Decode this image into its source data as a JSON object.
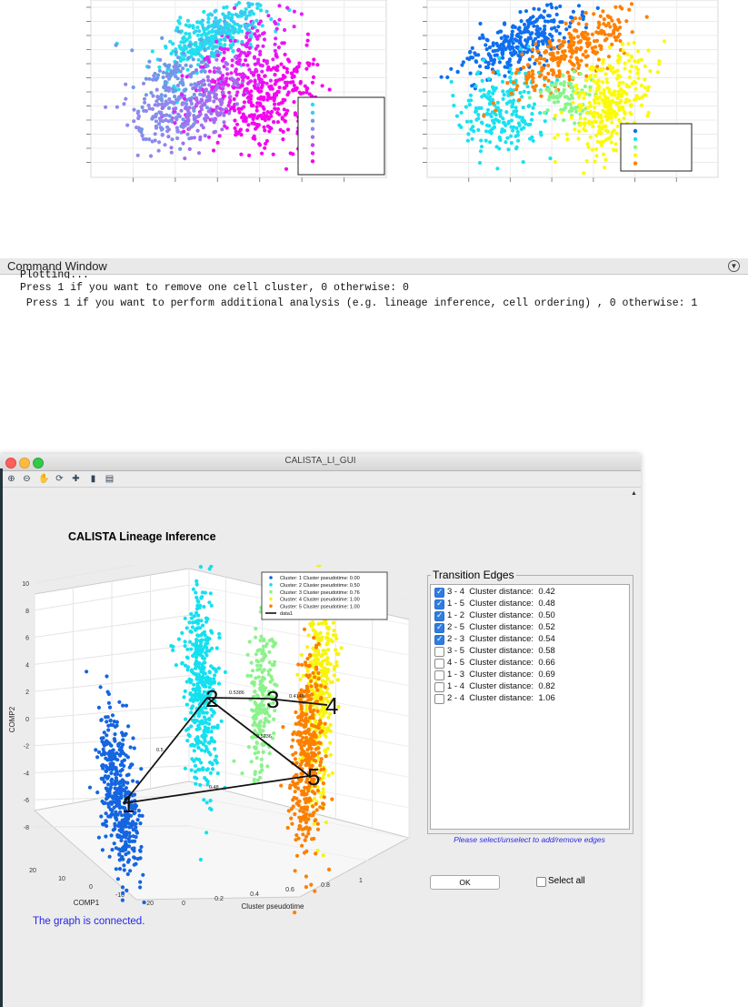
{
  "command_window": {
    "title": "Command Window",
    "lines": [
      "Plotting...",
      "Press 1 if you want to remove one cell cluster, 0 otherwise: 0",
      " Press 1 if you want to perform additional analysis (e.g. lineage inference, cell ordering) , 0 otherwise: 1"
    ]
  },
  "gui": {
    "window_title": "CALISTA_LI_GUI",
    "title": "CALISTA Lineage Inference",
    "toolbar_icons": [
      "zoom-in-icon",
      "zoom-out-icon",
      "pan-icon",
      "rotate-icon",
      "data-cursor-icon",
      "colorbar-icon",
      "legend-icon"
    ],
    "edges_panel_title": "Transition Edges",
    "edges": [
      {
        "label": "3 - 4  Cluster distance:  0.42",
        "checked": true
      },
      {
        "label": "1 - 5  Cluster distance:  0.48",
        "checked": true
      },
      {
        "label": "1 - 2  Cluster distance:  0.50",
        "checked": true
      },
      {
        "label": "2 - 5  Cluster distance:  0.52",
        "checked": true
      },
      {
        "label": "2 - 3  Cluster distance:  0.54",
        "checked": true
      },
      {
        "label": "3 - 5  Cluster distance:  0.58",
        "checked": false
      },
      {
        "label": "4 - 5  Cluster distance:  0.66",
        "checked": false
      },
      {
        "label": "1 - 3  Cluster distance:  0.69",
        "checked": false
      },
      {
        "label": "1 - 4  Cluster distance:  0.82",
        "checked": false
      },
      {
        "label": "2 - 4  Cluster distance:  1.06",
        "checked": false
      }
    ],
    "hint": "Please select/unselect to add/remove edges",
    "ok_label": "OK",
    "select_all_label": "Select all",
    "status": "The graph is connected."
  },
  "chart_data": [
    {
      "type": "scatter",
      "title": "",
      "series_colors": [
        "#1fe0f0",
        "#3fc8ef",
        "#6f99e8",
        "#8f88ee",
        "#a070f0",
        "#c23ef3",
        "#e21ff6",
        "#f405f0"
      ],
      "legend": {
        "placement": "bottom-right",
        "entries": 8
      }
    },
    {
      "type": "scatter",
      "title": "",
      "series_colors": [
        "#0e6ff0",
        "#18e2f0",
        "#86f58a",
        "#fbfa0c",
        "#ff8000"
      ],
      "legend": {
        "placement": "bottom-right",
        "entries": 5
      }
    },
    {
      "type": "scatter",
      "title": "",
      "xlabel": "Cluster pseudotime",
      "ylabel": "COMP2",
      "zlabel": "COMP1",
      "x_ticks": [
        "0",
        "0.2",
        "0.4",
        "0.6",
        "0.8",
        "1"
      ],
      "y_ticks": [
        "10",
        "8",
        "6",
        "4",
        "2",
        "0",
        "-2",
        "-4",
        "-6",
        "-8"
      ],
      "z_ticks": [
        "20",
        "10",
        "0",
        "-10",
        "-20"
      ],
      "legend": {
        "placement": "top-right",
        "entries": [
          {
            "label": "Cluster:   1 Cluster pseudotime: 0.00",
            "color": "#1565e0"
          },
          {
            "label": "Cluster:   2 Cluster pseudotime: 0.50",
            "color": "#14e0ef"
          },
          {
            "label": "Cluster:   3 Cluster pseudotime: 0.76",
            "color": "#8cf28c"
          },
          {
            "label": "Cluster:   4 Cluster pseudotime: 1.00",
            "color": "#f8f40b"
          },
          {
            "label": "Cluster:   5 Cluster pseudotime: 1.00",
            "color": "#fb8000"
          },
          {
            "label": "data1",
            "color": "#000000"
          }
        ]
      },
      "nodes": [
        "1",
        "2",
        "3",
        "4",
        "5"
      ],
      "edge_labels": [
        "0.5",
        "0.5386",
        "0.4146",
        "0.5236",
        "0.48"
      ]
    }
  ]
}
